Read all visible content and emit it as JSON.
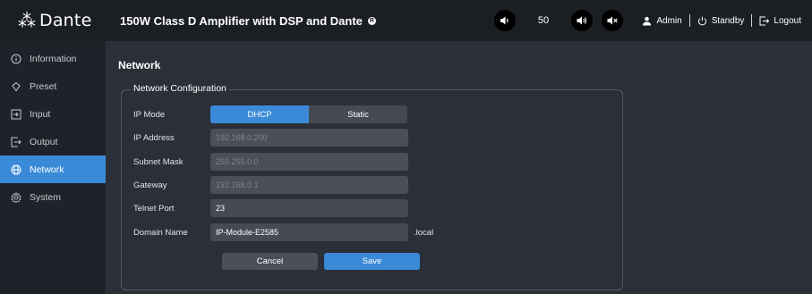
{
  "brand": {
    "logo_text": "Dante",
    "logo_mark": "⁂"
  },
  "sidebar": {
    "items": [
      {
        "label": "Information",
        "icon": "info-icon"
      },
      {
        "label": "Preset",
        "icon": "preset-icon"
      },
      {
        "label": "Input",
        "icon": "input-icon"
      },
      {
        "label": "Output",
        "icon": "output-icon"
      },
      {
        "label": "Network",
        "icon": "network-icon",
        "active": true
      },
      {
        "label": "System",
        "icon": "system-icon"
      }
    ]
  },
  "header": {
    "title": "150W Class D Amplifier with DSP and Dante",
    "registered_mark": "R",
    "volume": "50",
    "user": "Admin",
    "standby": "Standby",
    "logout": "Logout"
  },
  "main": {
    "page_title": "Network",
    "section_title": "Network Configuration",
    "ip_mode": {
      "label": "IP Mode",
      "options": [
        "DHCP",
        "Static"
      ],
      "selected": "DHCP"
    },
    "ip_address": {
      "label": "IP Address",
      "value": "192.168.0.200"
    },
    "subnet_mask": {
      "label": "Subnet Mask",
      "value": "255.255.0.0"
    },
    "gateway": {
      "label": "Gateway",
      "value": "192.168.0.1"
    },
    "telnet_port": {
      "label": "Telnet Port",
      "value": "23"
    },
    "domain_name": {
      "label": "Domain Name",
      "value": "IP-Module-E2585",
      "suffix": ".local"
    },
    "cancel_label": "Cancel",
    "save_label": "Save"
  },
  "colors": {
    "accent": "#3b8ad8",
    "sidebar_bg": "#1f2228",
    "header_bg": "#1b1e23",
    "main_bg": "#2b2f37"
  }
}
